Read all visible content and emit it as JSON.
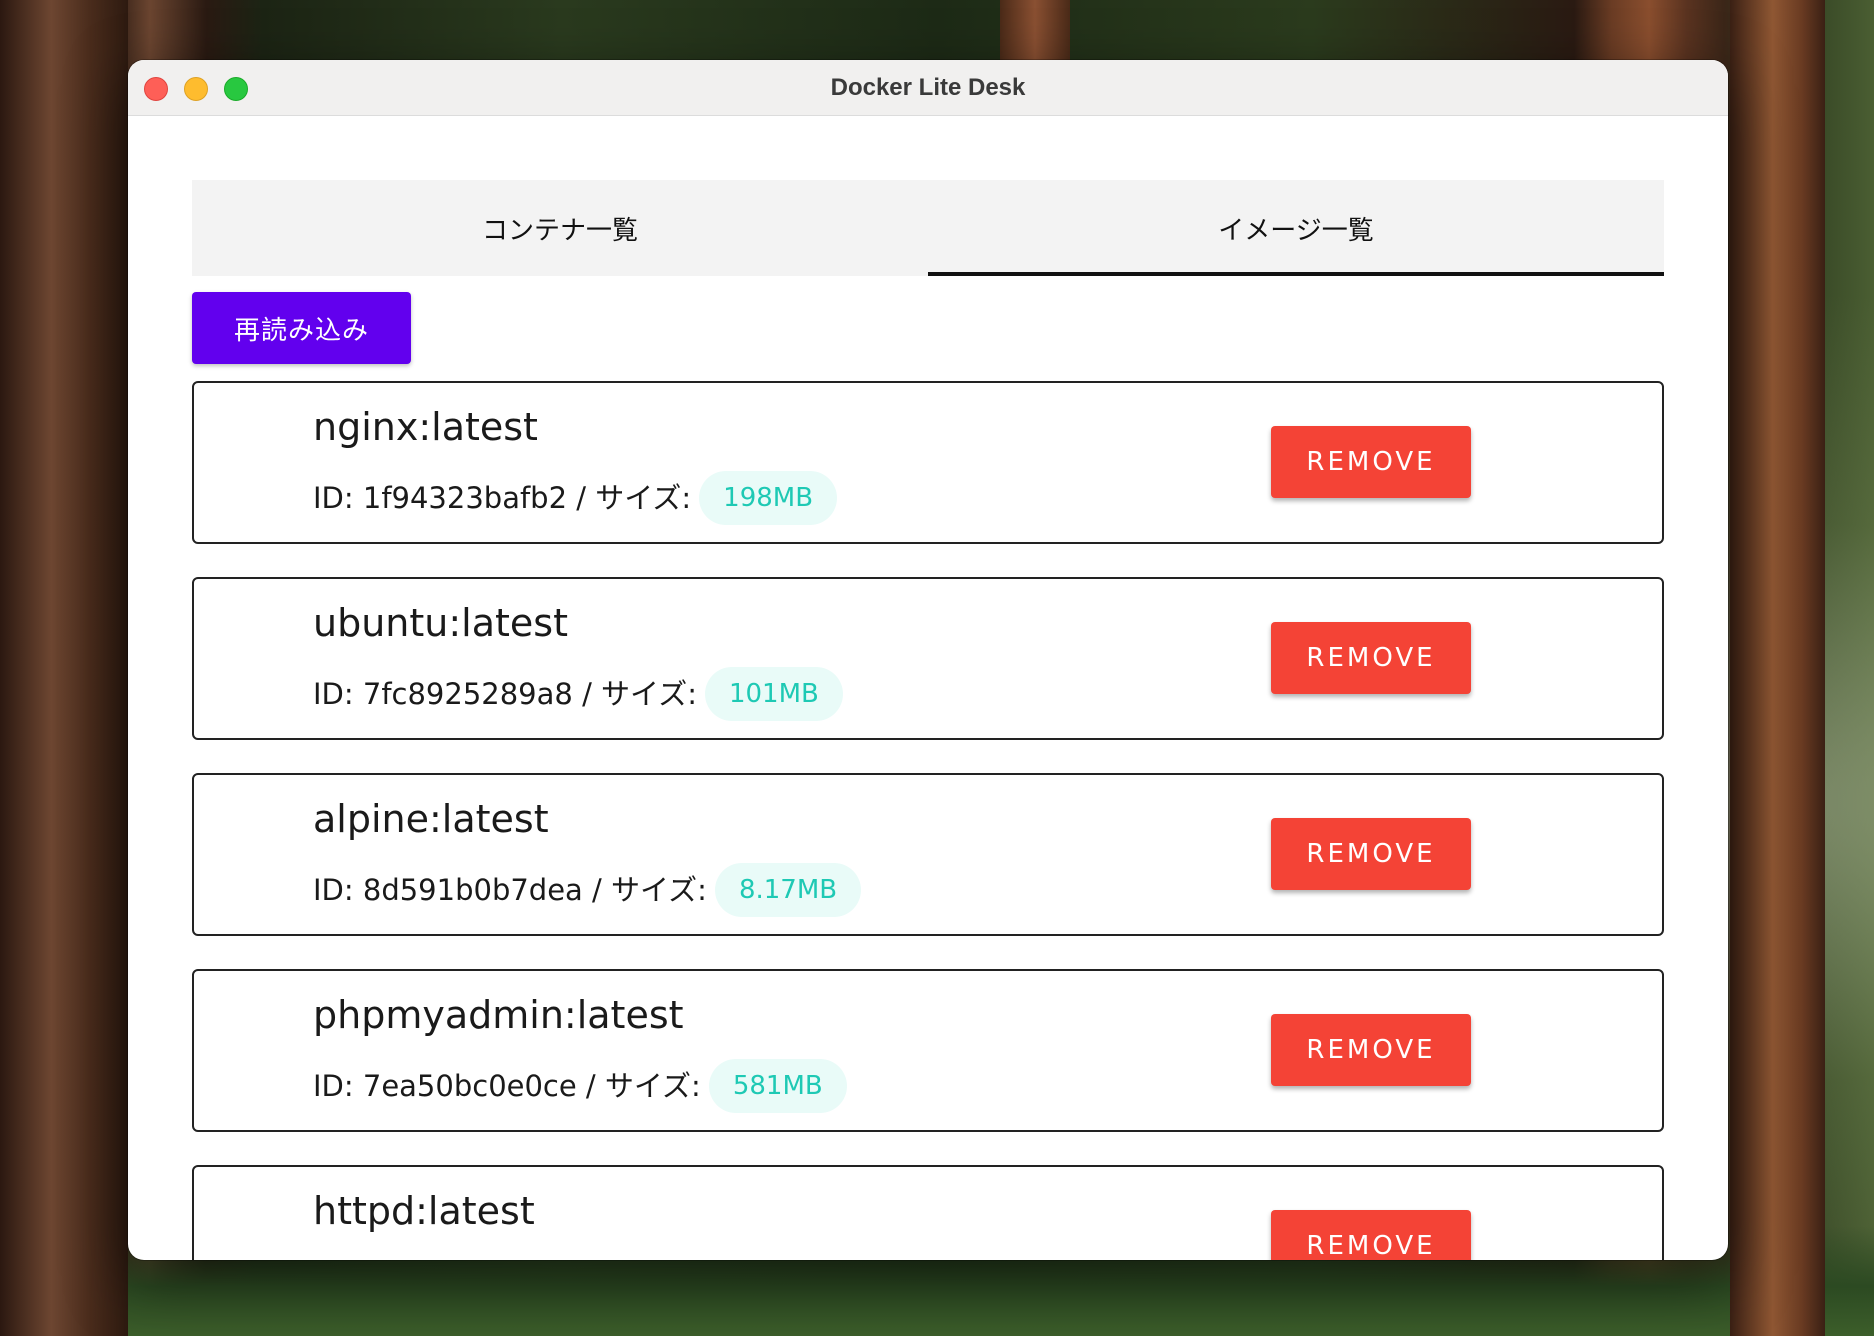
{
  "window": {
    "title": "Docker Lite Desk"
  },
  "tabs": [
    {
      "label": "コンテナ一覧",
      "active": false
    },
    {
      "label": "イメージ一覧",
      "active": true
    }
  ],
  "toolbar": {
    "reload_label": "再読み込み"
  },
  "images": [
    {
      "name": "nginx:latest",
      "meta": "ID: 1f94323bafb2 / サイズ:",
      "size": "198MB",
      "remove_label": "REMOVE"
    },
    {
      "name": "ubuntu:latest",
      "meta": "ID: 7fc8925289a8 / サイズ:",
      "size": "101MB",
      "remove_label": "REMOVE"
    },
    {
      "name": "alpine:latest",
      "meta": "ID: 8d591b0b7dea / サイズ:",
      "size": "8.17MB",
      "remove_label": "REMOVE"
    },
    {
      "name": "phpmyadmin:latest",
      "meta": "ID: 7ea50bc0e0ce / サイズ:",
      "size": "581MB",
      "remove_label": "REMOVE"
    },
    {
      "name": "httpd:latest",
      "meta": "",
      "size": "",
      "remove_label": "REMOVE"
    }
  ],
  "colors": {
    "reload_button": "#6200ee",
    "remove_button": "#f44336",
    "size_chip_text": "#1ec9b4",
    "size_chip_bg": "#e9fbf8"
  }
}
